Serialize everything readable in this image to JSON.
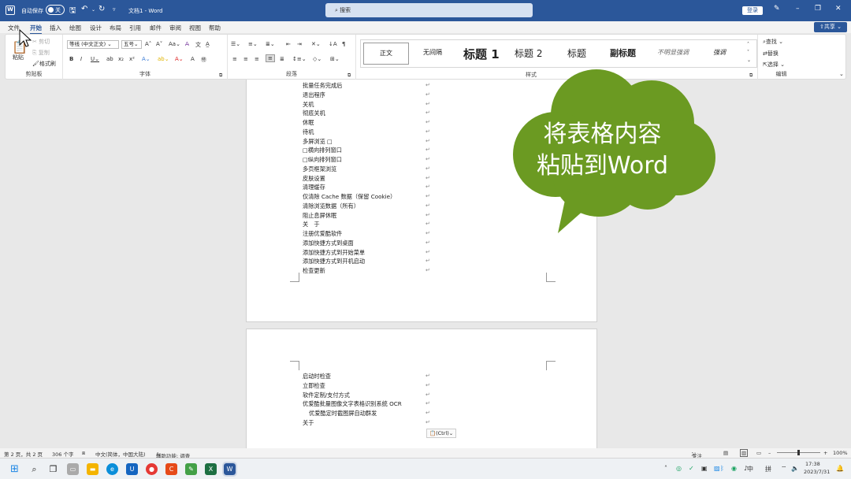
{
  "titlebar": {
    "autosave_label": "自动保存",
    "autosave_state": "关",
    "doc_title": "文档1 - Word",
    "search_placeholder": "搜索",
    "login_label": "登录"
  },
  "menu": {
    "tabs": [
      "文件",
      "开始",
      "插入",
      "绘图",
      "设计",
      "布局",
      "引用",
      "邮件",
      "审阅",
      "视图",
      "帮助"
    ],
    "share_label": "共享"
  },
  "ribbon": {
    "clipboard": {
      "paste": "粘贴",
      "cut": "剪切",
      "copy": "复制",
      "format_painter": "格式刷",
      "label": "剪贴板"
    },
    "font": {
      "font_name": "等线 (中文正文)",
      "font_size": "五号",
      "label": "字体"
    },
    "paragraph": {
      "label": "段落"
    },
    "styles": {
      "items": [
        "正文",
        "无间隔",
        "标题 1",
        "标题 2",
        "标题",
        "副标题",
        "不明显强调",
        "强调"
      ],
      "label": "样式"
    },
    "editing": {
      "find": "查找",
      "replace": "替换",
      "select": "选择",
      "label": "编辑"
    }
  },
  "doc": {
    "page1_lines": [
      "批量任务完成后",
      "退出程序",
      "关机",
      "彻底关机",
      "休眠",
      "待机",
      "多屏浏览 □",
      "□横向排列窗口",
      "□纵向排列窗口",
      "多页框架浏览",
      "皮肤设置",
      "清理缓存",
      "仅清除 Cache 数据（保留 Cookie）",
      "清除浏览数据（所有）",
      "阻止息屏休眠",
      "关　于",
      "注册优爱酷软件",
      "添加快捷方式到桌面",
      "添加快捷方式到开始菜单",
      "添加快捷方式到开机启动",
      "检查更新"
    ],
    "page2_lines": [
      "启动时检查",
      "立即检查",
      "软件定制/支付方式",
      "优爱酷批量图像文字表格识别系统 OCR",
      "优爱酷定时截图屏自动群发",
      "关于"
    ],
    "paste_options": "(Ctrl)"
  },
  "callout": {
    "line1": "将表格内容",
    "line2": "粘贴到Word"
  },
  "status": {
    "page": "第 2 页，共 2 页",
    "words": "306 个字",
    "language": "中文(简体，中国大陆)",
    "accessibility": "辅助功能: 调查",
    "focus": "专注",
    "zoom": "100%"
  },
  "taskbar": {
    "time": "17:38",
    "date": "2023/7/31",
    "ime_lang": "中",
    "ime_mode": "拼"
  },
  "colors": {
    "word_blue": "#2b579a",
    "callout_green": "#6b9a22"
  }
}
